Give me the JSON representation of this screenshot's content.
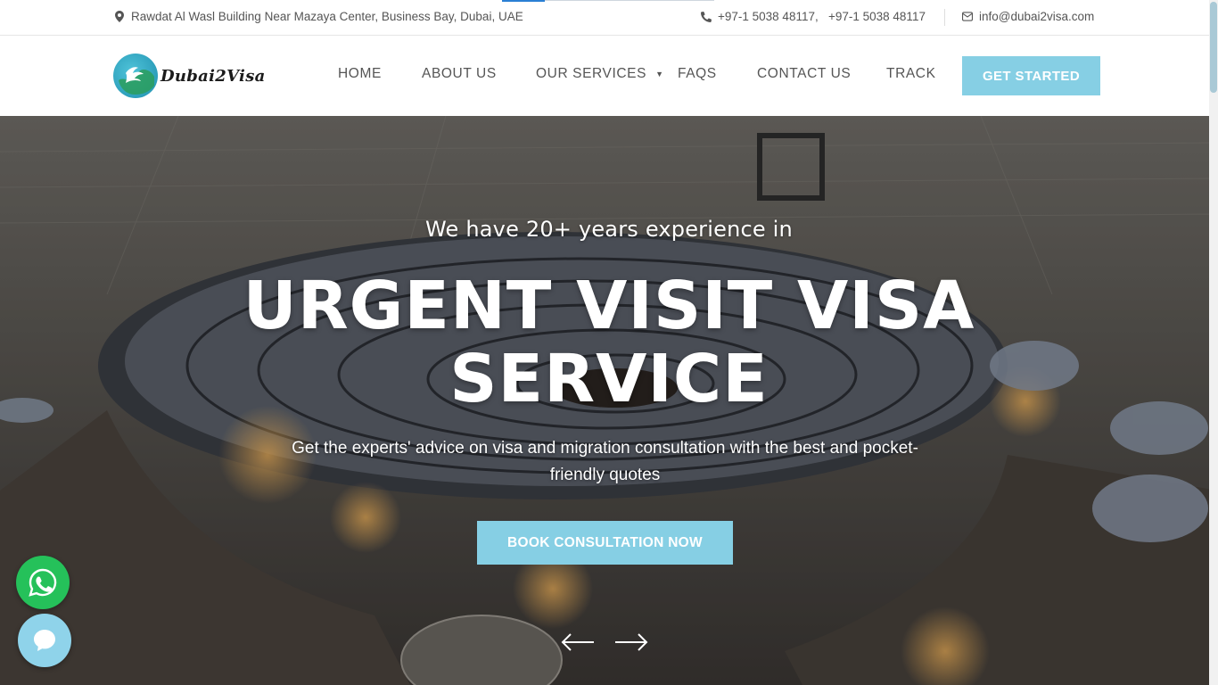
{
  "topbar": {
    "address": "Rawdat Al Wasl Building Near Mazaya Center, Business Bay, Dubai, UAE",
    "phones": "+97-1 5038 48117,   +97-1 5038 48117",
    "email": "info@dubai2visa.com",
    "icons": {
      "address": "map-marker-icon",
      "phone": "phone-icon",
      "email": "envelope-icon"
    }
  },
  "header": {
    "logo_text": "Dubai2Visa",
    "nav": [
      {
        "label": "HOME"
      },
      {
        "label": "ABOUT US"
      },
      {
        "label": "OUR SERVICES",
        "has_dropdown": true
      },
      {
        "label": "FAQS"
      },
      {
        "label": "CONTACT US"
      },
      {
        "label": "TRACK"
      }
    ],
    "cta_label": "GET STARTED"
  },
  "hero": {
    "subtitle": "We have 20+ years experience in",
    "title": "URGENT VISIT VISA SERVICE",
    "description": "Get the experts' advice on visa and migration consultation with the best and pocket-friendly quotes",
    "button_label": "BOOK CONSULTATION NOW"
  },
  "colors": {
    "accent": "#86cfe4",
    "whatsapp": "#25c15a",
    "text_muted": "#555555"
  }
}
